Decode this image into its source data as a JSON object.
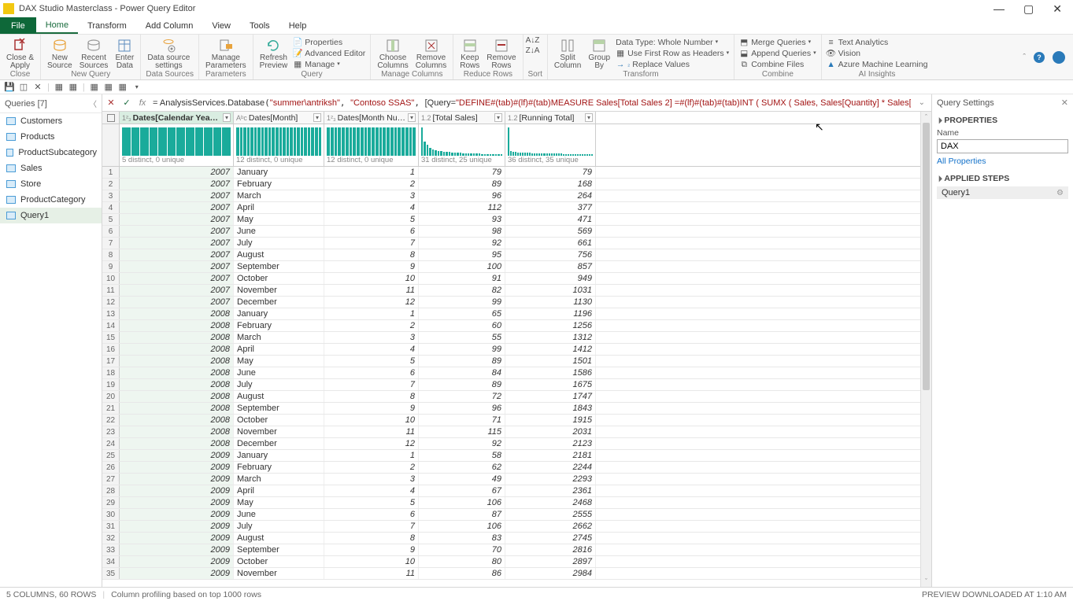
{
  "window": {
    "title": "DAX Studio Masterclass - Power Query Editor"
  },
  "menu": {
    "file": "File",
    "tabs": [
      "Home",
      "Transform",
      "Add Column",
      "View",
      "Tools",
      "Help"
    ]
  },
  "ribbon": {
    "close_apply": "Close &\nApply",
    "close_group": "Close",
    "new_source": "New\nSource",
    "recent_sources": "Recent\nSources",
    "enter_data": "Enter\nData",
    "new_query_group": "New Query",
    "data_source_settings": "Data source\nsettings",
    "data_sources_group": "Data Sources",
    "manage_params": "Manage\nParameters",
    "params_group": "Parameters",
    "refresh": "Refresh\nPreview",
    "properties": "Properties",
    "adv_editor": "Advanced Editor",
    "manage": "Manage",
    "query_group": "Query",
    "choose_cols": "Choose\nColumns",
    "remove_cols": "Remove\nColumns",
    "manage_cols_group": "Manage Columns",
    "keep_rows": "Keep\nRows",
    "remove_rows": "Remove\nRows",
    "reduce_rows_group": "Reduce Rows",
    "sort_group": "Sort",
    "split_col": "Split\nColumn",
    "group_by": "Group\nBy",
    "data_type": "Data Type: Whole Number",
    "first_row": "Use First Row as Headers",
    "replace": "Replace Values",
    "transform_group": "Transform",
    "merge": "Merge Queries",
    "append": "Append Queries",
    "combine_files": "Combine Files",
    "combine_group": "Combine",
    "text_analytics": "Text Analytics",
    "vision": "Vision",
    "azure_ml": "Azure Machine Learning",
    "ai_group": "AI Insights"
  },
  "queries_pane": {
    "header": "Queries [7]",
    "items": [
      "Customers",
      "Products",
      "ProductSubcategory",
      "Sales",
      "Store",
      "ProductCategory",
      "Query1"
    ],
    "selected": 6
  },
  "formula": {
    "prefix": "= ",
    "fn1": "AnalysisServices.Database",
    "arg1": "\"summer\\antriksh\"",
    "arg2": "\"Contoso SSAS\"",
    "query_label": "[Query=",
    "query_str": "\"DEFINE#(tab)#(lf)#(tab)MEASURE Sales[Total Sales 2] =#(lf)#(tab)#(tab)INT ( SUMX ( Sales, Sales[Quantity] * Sales[Net Price] )  )"
  },
  "columns": [
    {
      "name": "Dates[Calendar Year Number]",
      "type": "1²₃",
      "stat": "5 distinct, 0 unique",
      "sel": true,
      "bars": [
        36,
        36,
        36,
        36,
        36,
        36,
        36,
        36,
        36,
        36,
        36,
        36
      ]
    },
    {
      "name": "Dates[Month]",
      "type": "Aᵇc",
      "stat": "12 distinct, 0 unique",
      "bars": [
        36,
        36,
        36,
        36,
        36,
        36,
        36,
        36,
        36,
        36,
        36,
        36,
        36,
        36,
        36,
        36,
        36,
        36,
        36,
        36,
        36,
        36,
        36,
        36
      ]
    },
    {
      "name": "Dates[Month Number]",
      "type": "1²₃",
      "stat": "12 distinct, 0 unique",
      "bars": [
        36,
        36,
        36,
        36,
        36,
        36,
        36,
        36,
        36,
        36,
        36,
        36,
        36,
        36,
        36,
        36,
        36,
        36,
        36,
        36,
        36,
        36,
        36,
        36
      ]
    },
    {
      "name": "[Total Sales]",
      "type": "1.2",
      "stat": "31 distinct, 25 unique",
      "bars": [
        36,
        18,
        14,
        10,
        8,
        7,
        6,
        6,
        5,
        5,
        5,
        4,
        4,
        4,
        4,
        3,
        3,
        3,
        3,
        3,
        3,
        3,
        2,
        2,
        2,
        2,
        2,
        2,
        2,
        2
      ]
    },
    {
      "name": "[Running Total]",
      "type": "1.2",
      "stat": "36 distinct, 35 unique",
      "bars": [
        36,
        6,
        5,
        5,
        4,
        4,
        4,
        4,
        4,
        4,
        3,
        3,
        3,
        3,
        3,
        3,
        3,
        3,
        3,
        3,
        3,
        3,
        3,
        2,
        2,
        2,
        2,
        2,
        2,
        2,
        2,
        2,
        2,
        2,
        2,
        2
      ]
    }
  ],
  "rows": [
    [
      2007,
      "January",
      1,
      79,
      79
    ],
    [
      2007,
      "February",
      2,
      89,
      168
    ],
    [
      2007,
      "March",
      3,
      96,
      264
    ],
    [
      2007,
      "April",
      4,
      112,
      377
    ],
    [
      2007,
      "May",
      5,
      93,
      471
    ],
    [
      2007,
      "June",
      6,
      98,
      569
    ],
    [
      2007,
      "July",
      7,
      92,
      661
    ],
    [
      2007,
      "August",
      8,
      95,
      756
    ],
    [
      2007,
      "September",
      9,
      100,
      857
    ],
    [
      2007,
      "October",
      10,
      91,
      949
    ],
    [
      2007,
      "November",
      11,
      82,
      1031
    ],
    [
      2007,
      "December",
      12,
      99,
      1130
    ],
    [
      2008,
      "January",
      1,
      65,
      1196
    ],
    [
      2008,
      "February",
      2,
      60,
      1256
    ],
    [
      2008,
      "March",
      3,
      55,
      1312
    ],
    [
      2008,
      "April",
      4,
      99,
      1412
    ],
    [
      2008,
      "May",
      5,
      89,
      1501
    ],
    [
      2008,
      "June",
      6,
      84,
      1586
    ],
    [
      2008,
      "July",
      7,
      89,
      1675
    ],
    [
      2008,
      "August",
      8,
      72,
      1747
    ],
    [
      2008,
      "September",
      9,
      96,
      1843
    ],
    [
      2008,
      "October",
      10,
      71,
      1915
    ],
    [
      2008,
      "November",
      11,
      115,
      2031
    ],
    [
      2008,
      "December",
      12,
      92,
      2123
    ],
    [
      2009,
      "January",
      1,
      58,
      2181
    ],
    [
      2009,
      "February",
      2,
      62,
      2244
    ],
    [
      2009,
      "March",
      3,
      49,
      2293
    ],
    [
      2009,
      "April",
      4,
      67,
      2361
    ],
    [
      2009,
      "May",
      5,
      106,
      2468
    ],
    [
      2009,
      "June",
      6,
      87,
      2555
    ],
    [
      2009,
      "July",
      7,
      106,
      2662
    ],
    [
      2009,
      "August",
      8,
      83,
      2745
    ],
    [
      2009,
      "September",
      9,
      70,
      2816
    ],
    [
      2009,
      "October",
      10,
      80,
      2897
    ],
    [
      2009,
      "November",
      11,
      86,
      2984
    ]
  ],
  "settings": {
    "header": "Query Settings",
    "properties": "PROPERTIES",
    "name_label": "Name",
    "name_value": "DAX ",
    "all_props": "All Properties",
    "applied_steps": "APPLIED STEPS",
    "step1": "Query1"
  },
  "status": {
    "left1": "5 COLUMNS, 60 ROWS",
    "left2": "Column profiling based on top 1000 rows",
    "right": "PREVIEW DOWNLOADED AT 1:10 AM"
  }
}
